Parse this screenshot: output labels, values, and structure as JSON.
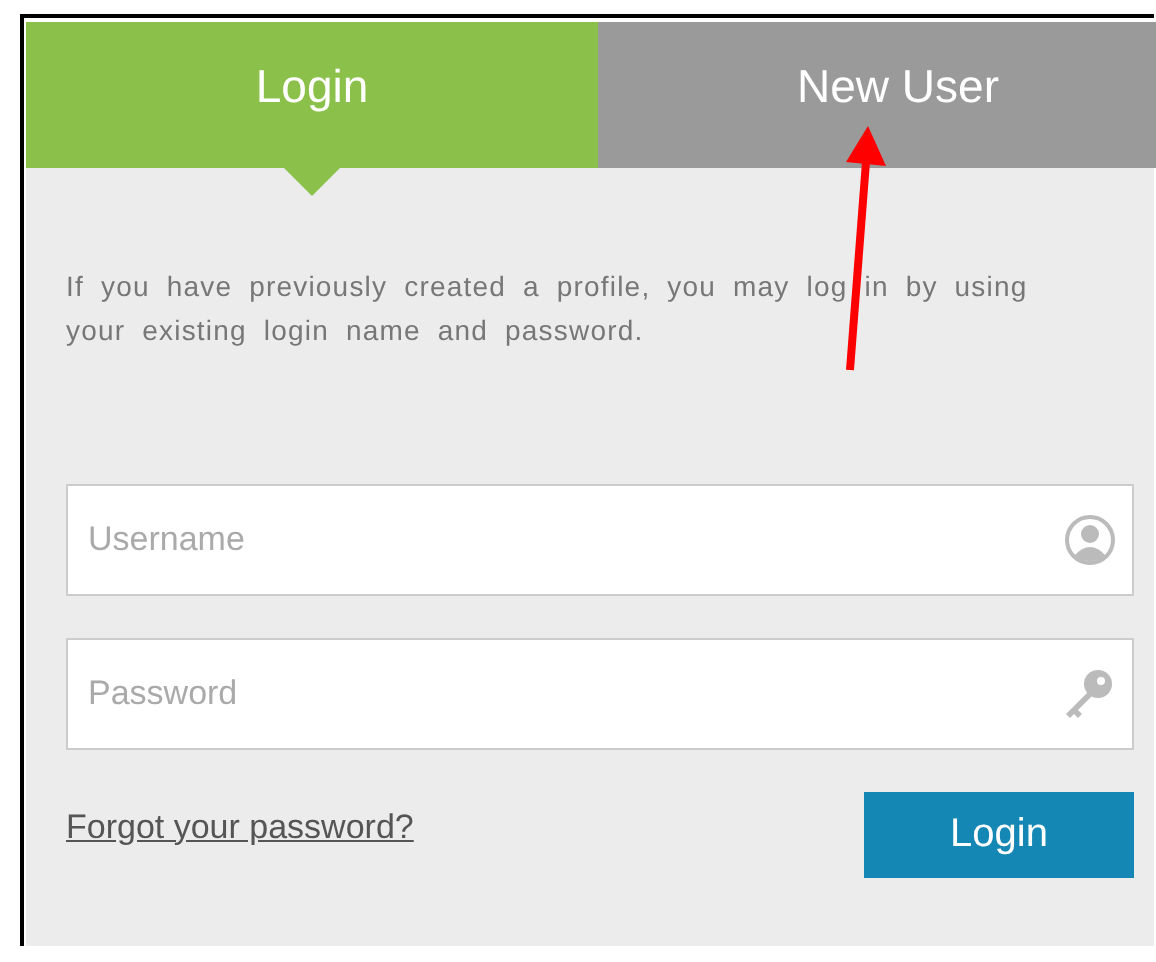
{
  "tabs": [
    {
      "label": "Login",
      "selected": true
    },
    {
      "label": "New User",
      "selected": false
    }
  ],
  "intro": "If you have previously created a profile, you may log in by using your existing login name and password.",
  "fields": [
    {
      "kind": "user",
      "placeholder": "Username"
    },
    {
      "kind": "password",
      "placeholder": "Password"
    }
  ],
  "forgot_link": "Forgot your password?",
  "submit": "Login"
}
